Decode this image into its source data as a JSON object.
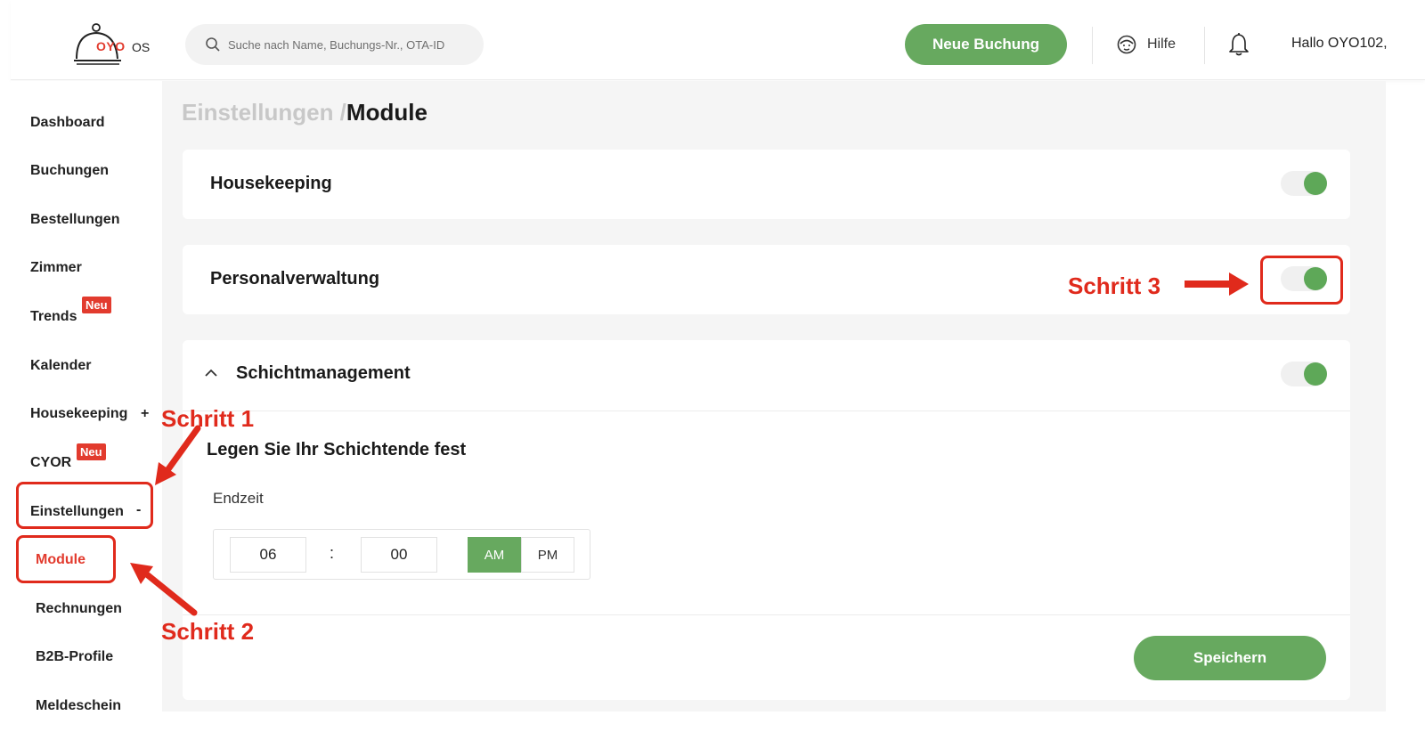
{
  "header": {
    "logo": {
      "brand": "OYO",
      "suffix": "OS"
    },
    "search": {
      "placeholder": "Suche nach Name, Buchungs-Nr., OTA-ID"
    },
    "new_booking_label": "Neue Buchung",
    "help_label": "Hilfe",
    "greeting": "Hallo OYO102,"
  },
  "sidebar": {
    "items": [
      {
        "label": "Dashboard"
      },
      {
        "label": "Buchungen"
      },
      {
        "label": "Bestellungen"
      },
      {
        "label": "Zimmer"
      },
      {
        "label": "Trends",
        "badge": "Neu"
      },
      {
        "label": "Kalender"
      },
      {
        "label": "Housekeeping",
        "suffix": "+"
      },
      {
        "label": "CYOR",
        "badge": "Neu"
      },
      {
        "label": "Einstellungen",
        "suffix": "-"
      },
      {
        "label": "Module",
        "active": true
      },
      {
        "label": "Rechnungen"
      },
      {
        "label": "B2B-Profile"
      },
      {
        "label": "Meldeschein"
      }
    ]
  },
  "main": {
    "breadcrumb": {
      "parent": "Einstellungen /",
      "current": "Module"
    },
    "modules": [
      {
        "title": "Housekeeping",
        "enabled": true
      },
      {
        "title": "Personalverwaltung",
        "enabled": true
      },
      {
        "title": "Schichtmanagement",
        "enabled": true,
        "expanded": true
      }
    ],
    "shift": {
      "subtitle": "Legen Sie Ihr Schichtende fest",
      "end_label": "Endzeit",
      "hour": "06",
      "colon": ":",
      "minute": "00",
      "am": "AM",
      "pm": "PM",
      "selected_period": "AM",
      "save_label": "Speichern"
    }
  },
  "annotations": {
    "step1": "Schritt 1",
    "step2": "Schritt 2",
    "step3": "Schritt 3"
  },
  "colors": {
    "accent_green": "#67a95f",
    "brand_red": "#e23b2e",
    "annotation_red": "#e02a1c"
  }
}
